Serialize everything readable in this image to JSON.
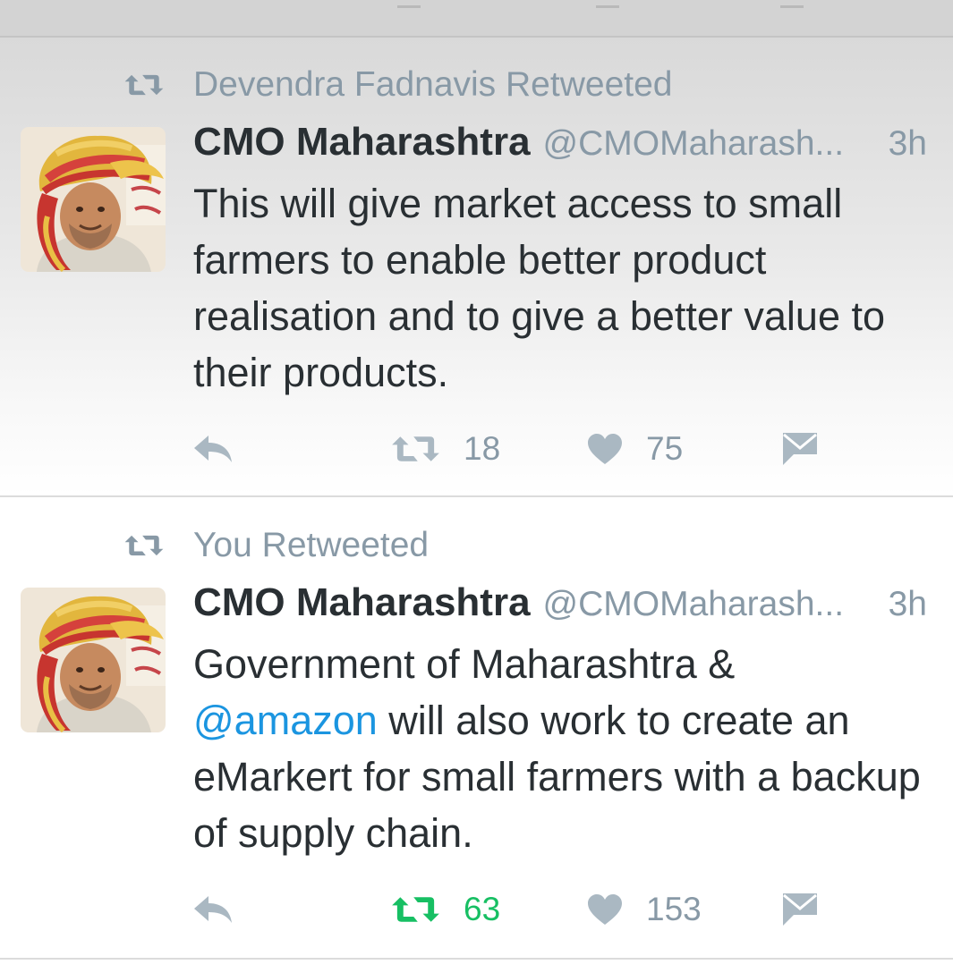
{
  "colors": {
    "name": "#292f33",
    "meta": "#8899a6",
    "mention": "#1b95e0",
    "retweeted": "#17bf63",
    "icon": "#aab8c2"
  },
  "tweets": [
    {
      "retweet_label": "Devendra Fadnavis Retweeted",
      "author_name": "CMO Maharashtra",
      "author_handle": "@CMOMaharash...",
      "time": "3h",
      "text": "This will give market access to small farmers to enable better product realisation and to give a better value to their products.",
      "retweet_count": "18",
      "like_count": "75",
      "retweeted_by_me": false,
      "icons": [
        "retweet-icon",
        "avatar",
        "reply-icon",
        "retweet-icon",
        "heart-icon",
        "message-icon"
      ]
    },
    {
      "retweet_label": "You Retweeted",
      "author_name": "CMO Maharashtra",
      "author_handle": "@CMOMaharash...",
      "time": "3h",
      "text_before": "Government of Maharashtra &",
      "mention": "@amazon",
      "text_after": " will also work to create an eMarkert for small farmers with a backup of supply chain.",
      "retweet_count": "63",
      "like_count": "153",
      "retweeted_by_me": true,
      "icons": [
        "retweet-icon",
        "avatar",
        "reply-icon",
        "retweet-icon",
        "heart-icon",
        "message-icon"
      ]
    }
  ]
}
